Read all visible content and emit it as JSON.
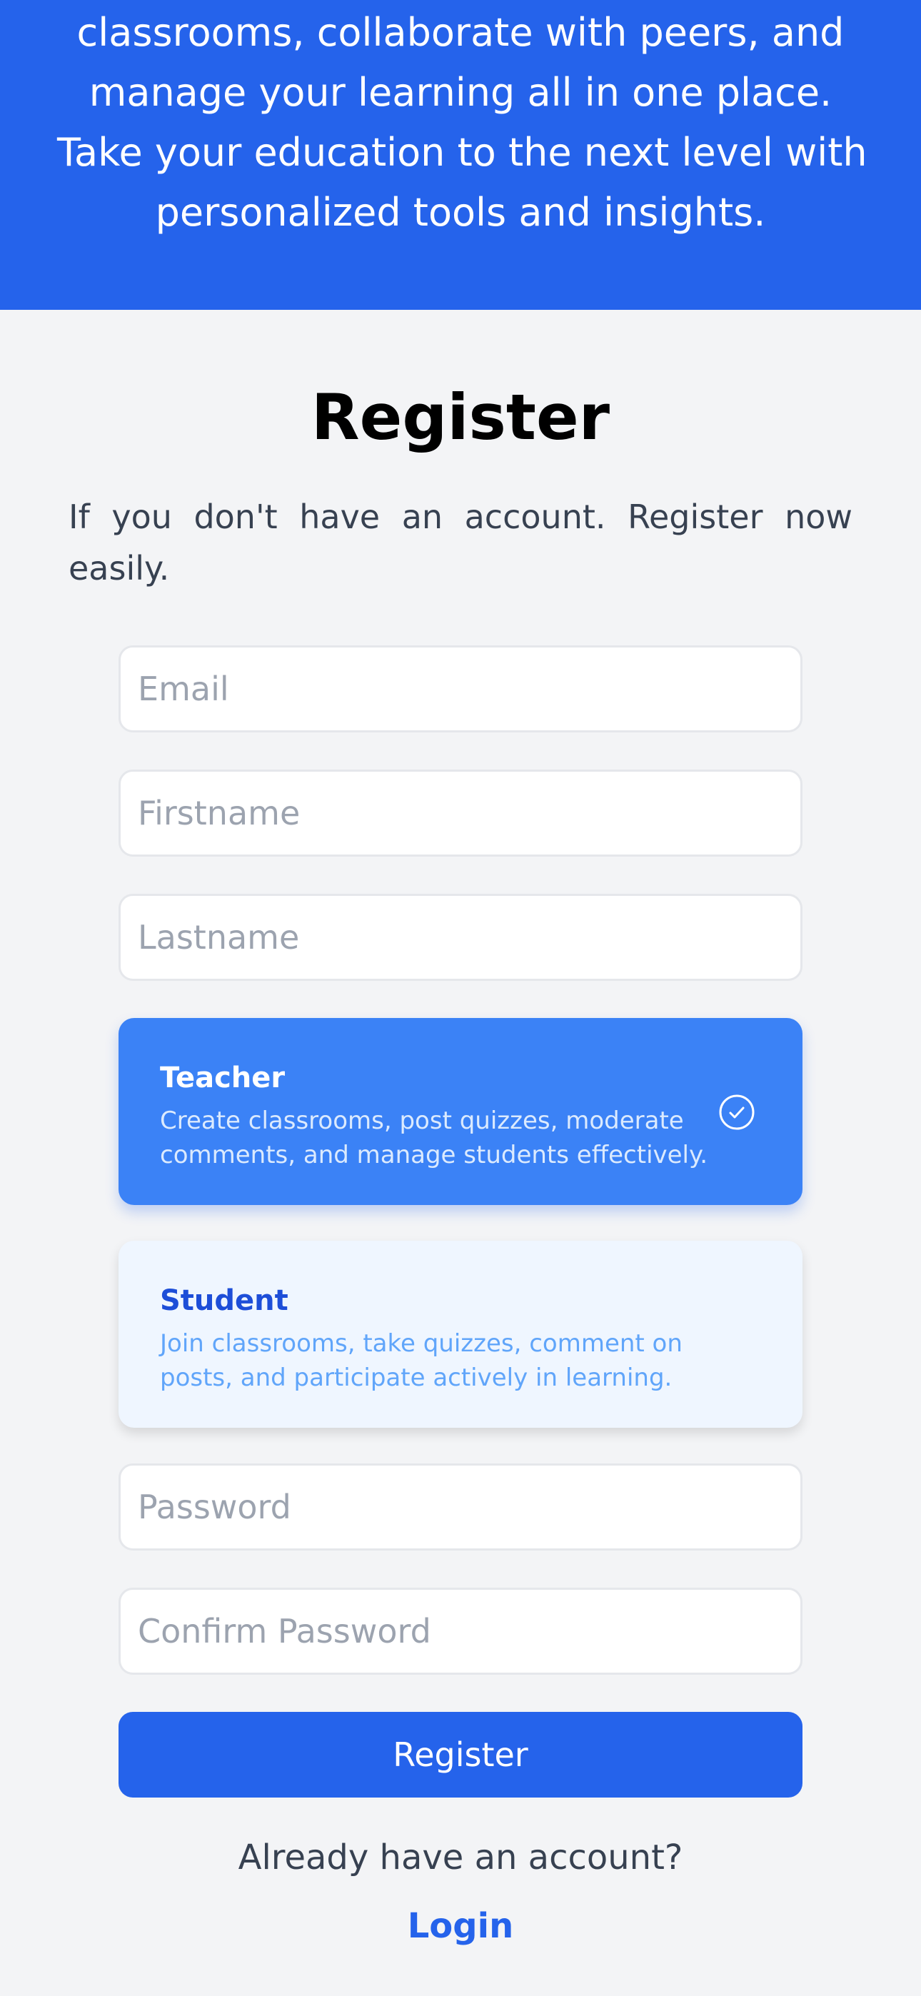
{
  "hero": {
    "lines": [
      "classrooms, collaborate with peers, and",
      "manage your learning all in one place.",
      "Take your education to the next level with",
      "personalized tools and insights."
    ]
  },
  "register": {
    "title": "Register",
    "intro": "If you don't have an account. Register now easily."
  },
  "form": {
    "email_placeholder": "Email",
    "firstname_placeholder": "Firstname",
    "lastname_placeholder": "Lastname",
    "password_placeholder": "Password",
    "confirm_password_placeholder": "Confirm Password",
    "submit_label": "Register"
  },
  "roles": [
    {
      "title": "Teacher",
      "description": "Create classrooms, post quizzes, moderate comments, and manage students effectively.",
      "selected": true,
      "icon": "check-circle-icon"
    },
    {
      "title": "Student",
      "description": "Join classrooms, take quizzes, comment on posts, and participate actively in learning.",
      "selected": false
    }
  ],
  "footer": {
    "prompt": "Already have an account?",
    "login_label": "Login"
  },
  "colors": {
    "primary": "#2563eb",
    "selected_card": "#3b82f6",
    "unselected_card": "#eff6ff",
    "background": "#f3f4f6"
  }
}
